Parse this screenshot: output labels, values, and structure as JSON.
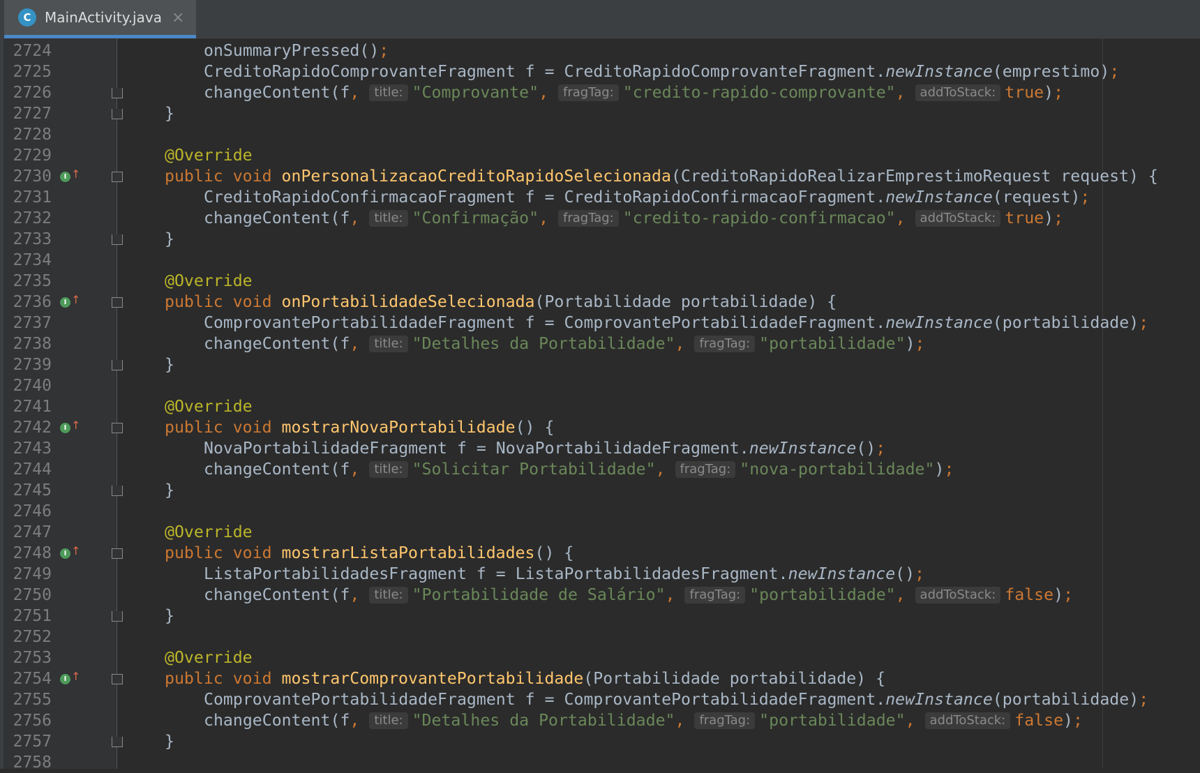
{
  "tab": {
    "title": "MainActivity.java",
    "icon": "class-icon",
    "icon_letter": "C",
    "close": "×"
  },
  "colors": {
    "keyword": "#cc7832",
    "annotation": "#bbb529",
    "method": "#ffc66d",
    "string": "#6a8759",
    "text": "#a9b7c6",
    "background": "#2b2b2b",
    "gutter": "#313335"
  },
  "lines": [
    {
      "n": "2724",
      "indent": 2,
      "tokens": [
        [
          "t",
          "onSummaryPressed()"
        ],
        [
          "k",
          ";"
        ]
      ]
    },
    {
      "n": "2725",
      "indent": 2,
      "tokens": [
        [
          "t",
          "CreditoRapidoComprovanteFragment f = CreditoRapidoComprovanteFragment."
        ],
        [
          "it",
          "newInstance"
        ],
        [
          "t",
          "(emprestimo)"
        ],
        [
          "k",
          ";"
        ]
      ]
    },
    {
      "n": "2726",
      "indent": 2,
      "fold": "end",
      "tokens": [
        [
          "t",
          "changeContent(f"
        ],
        [
          "k",
          ", "
        ],
        [
          "h",
          "title:"
        ],
        [
          "s",
          "\"Comprovante\""
        ],
        [
          "k",
          ", "
        ],
        [
          "h",
          "fragTag:"
        ],
        [
          "s",
          "\"credito-rapido-comprovante\""
        ],
        [
          "k",
          ", "
        ],
        [
          "h",
          "addToStack:"
        ],
        [
          "k",
          "true"
        ],
        [
          "t",
          ")"
        ],
        [
          "k",
          ";"
        ]
      ]
    },
    {
      "n": "2727",
      "indent": 1,
      "fold": "end",
      "tokens": [
        [
          "t",
          "}"
        ]
      ]
    },
    {
      "n": "2728",
      "indent": 0,
      "tokens": []
    },
    {
      "n": "2729",
      "indent": 1,
      "tokens": [
        [
          "an",
          "@Override"
        ]
      ]
    },
    {
      "n": "2730",
      "indent": 1,
      "marker": true,
      "fold": "start",
      "tokens": [
        [
          "k",
          "public void "
        ],
        [
          "m",
          "onPersonalizacaoCreditoRapidoSelecionada"
        ],
        [
          "t",
          "(CreditoRapidoRealizarEmprestimoRequest request) {"
        ]
      ]
    },
    {
      "n": "2731",
      "indent": 2,
      "tokens": [
        [
          "t",
          "CreditoRapidoConfirmacaoFragment f = CreditoRapidoConfirmacaoFragment."
        ],
        [
          "it",
          "newInstance"
        ],
        [
          "t",
          "(request)"
        ],
        [
          "k",
          ";"
        ]
      ]
    },
    {
      "n": "2732",
      "indent": 2,
      "tokens": [
        [
          "t",
          "changeContent(f"
        ],
        [
          "k",
          ", "
        ],
        [
          "h",
          "title:"
        ],
        [
          "s",
          "\"Confirmação\""
        ],
        [
          "k",
          ", "
        ],
        [
          "h",
          "fragTag:"
        ],
        [
          "s",
          "\"credito-rapido-confirmacao\""
        ],
        [
          "k",
          ", "
        ],
        [
          "h",
          "addToStack:"
        ],
        [
          "k",
          "true"
        ],
        [
          "t",
          ")"
        ],
        [
          "k",
          ";"
        ]
      ]
    },
    {
      "n": "2733",
      "indent": 1,
      "fold": "end",
      "tokens": [
        [
          "t",
          "}"
        ]
      ]
    },
    {
      "n": "2734",
      "indent": 0,
      "tokens": []
    },
    {
      "n": "2735",
      "indent": 1,
      "tokens": [
        [
          "an",
          "@Override"
        ]
      ]
    },
    {
      "n": "2736",
      "indent": 1,
      "marker": true,
      "fold": "start",
      "tokens": [
        [
          "k",
          "public void "
        ],
        [
          "m",
          "onPortabilidadeSelecionada"
        ],
        [
          "t",
          "(Portabilidade portabilidade) {"
        ]
      ]
    },
    {
      "n": "2737",
      "indent": 2,
      "tokens": [
        [
          "t",
          "ComprovantePortabilidadeFragment f = ComprovantePortabilidadeFragment."
        ],
        [
          "it",
          "newInstance"
        ],
        [
          "t",
          "(portabilidade)"
        ],
        [
          "k",
          ";"
        ]
      ]
    },
    {
      "n": "2738",
      "indent": 2,
      "tokens": [
        [
          "t",
          "changeContent(f"
        ],
        [
          "k",
          ", "
        ],
        [
          "h",
          "title:"
        ],
        [
          "s",
          "\"Detalhes da Portabilidade\""
        ],
        [
          "k",
          ", "
        ],
        [
          "h",
          "fragTag:"
        ],
        [
          "s",
          "\"portabilidade\""
        ],
        [
          "t",
          ")"
        ],
        [
          "k",
          ";"
        ]
      ]
    },
    {
      "n": "2739",
      "indent": 1,
      "fold": "end",
      "tokens": [
        [
          "t",
          "}"
        ]
      ]
    },
    {
      "n": "2740",
      "indent": 0,
      "tokens": []
    },
    {
      "n": "2741",
      "indent": 1,
      "tokens": [
        [
          "an",
          "@Override"
        ]
      ]
    },
    {
      "n": "2742",
      "indent": 1,
      "marker": true,
      "fold": "start",
      "tokens": [
        [
          "k",
          "public void "
        ],
        [
          "m",
          "mostrarNovaPortabilidade"
        ],
        [
          "t",
          "() {"
        ]
      ]
    },
    {
      "n": "2743",
      "indent": 2,
      "tokens": [
        [
          "t",
          "NovaPortabilidadeFragment f = NovaPortabilidadeFragment."
        ],
        [
          "it",
          "newInstance"
        ],
        [
          "t",
          "()"
        ],
        [
          "k",
          ";"
        ]
      ]
    },
    {
      "n": "2744",
      "indent": 2,
      "tokens": [
        [
          "t",
          "changeContent(f"
        ],
        [
          "k",
          ", "
        ],
        [
          "h",
          "title:"
        ],
        [
          "s",
          "\"Solicitar Portabilidade\""
        ],
        [
          "k",
          ", "
        ],
        [
          "h",
          "fragTag:"
        ],
        [
          "s",
          "\"nova-portabilidade\""
        ],
        [
          "t",
          ")"
        ],
        [
          "k",
          ";"
        ]
      ]
    },
    {
      "n": "2745",
      "indent": 1,
      "fold": "end",
      "tokens": [
        [
          "t",
          "}"
        ]
      ]
    },
    {
      "n": "2746",
      "indent": 0,
      "tokens": []
    },
    {
      "n": "2747",
      "indent": 1,
      "tokens": [
        [
          "an",
          "@Override"
        ]
      ]
    },
    {
      "n": "2748",
      "indent": 1,
      "marker": true,
      "fold": "start",
      "tokens": [
        [
          "k",
          "public void "
        ],
        [
          "m",
          "mostrarListaPortabilidades"
        ],
        [
          "t",
          "() {"
        ]
      ]
    },
    {
      "n": "2749",
      "indent": 2,
      "tokens": [
        [
          "t",
          "ListaPortabilidadesFragment f = ListaPortabilidadesFragment."
        ],
        [
          "it",
          "newInstance"
        ],
        [
          "t",
          "()"
        ],
        [
          "k",
          ";"
        ]
      ]
    },
    {
      "n": "2750",
      "indent": 2,
      "tokens": [
        [
          "t",
          "changeContent(f"
        ],
        [
          "k",
          ", "
        ],
        [
          "h",
          "title:"
        ],
        [
          "s",
          "\"Portabilidade de Salário\""
        ],
        [
          "k",
          ", "
        ],
        [
          "h",
          "fragTag:"
        ],
        [
          "s",
          "\"portabilidade\""
        ],
        [
          "k",
          ", "
        ],
        [
          "h",
          "addToStack:"
        ],
        [
          "k",
          "false"
        ],
        [
          "t",
          ")"
        ],
        [
          "k",
          ";"
        ]
      ]
    },
    {
      "n": "2751",
      "indent": 1,
      "fold": "end",
      "tokens": [
        [
          "t",
          "}"
        ]
      ]
    },
    {
      "n": "2752",
      "indent": 0,
      "tokens": []
    },
    {
      "n": "2753",
      "indent": 1,
      "tokens": [
        [
          "an",
          "@Override"
        ]
      ]
    },
    {
      "n": "2754",
      "indent": 1,
      "marker": true,
      "fold": "start",
      "tokens": [
        [
          "k",
          "public void "
        ],
        [
          "m",
          "mostrarComprovantePortabilidade"
        ],
        [
          "t",
          "(Portabilidade portabilidade) {"
        ]
      ]
    },
    {
      "n": "2755",
      "indent": 2,
      "tokens": [
        [
          "t",
          "ComprovantePortabilidadeFragment f = ComprovantePortabilidadeFragment."
        ],
        [
          "it",
          "newInstance"
        ],
        [
          "t",
          "(portabilidade)"
        ],
        [
          "k",
          ";"
        ]
      ]
    },
    {
      "n": "2756",
      "indent": 2,
      "tokens": [
        [
          "t",
          "changeContent(f"
        ],
        [
          "k",
          ", "
        ],
        [
          "h",
          "title:"
        ],
        [
          "s",
          "\"Detalhes da Portabilidade\""
        ],
        [
          "k",
          ", "
        ],
        [
          "h",
          "fragTag:"
        ],
        [
          "s",
          "\"portabilidade\""
        ],
        [
          "k",
          ", "
        ],
        [
          "h",
          "addToStack:"
        ],
        [
          "k",
          "false"
        ],
        [
          "t",
          ")"
        ],
        [
          "k",
          ";"
        ]
      ]
    },
    {
      "n": "2757",
      "indent": 1,
      "fold": "end",
      "tokens": [
        [
          "t",
          "}"
        ]
      ]
    },
    {
      "n": "2758",
      "indent": 0,
      "tokens": []
    }
  ]
}
